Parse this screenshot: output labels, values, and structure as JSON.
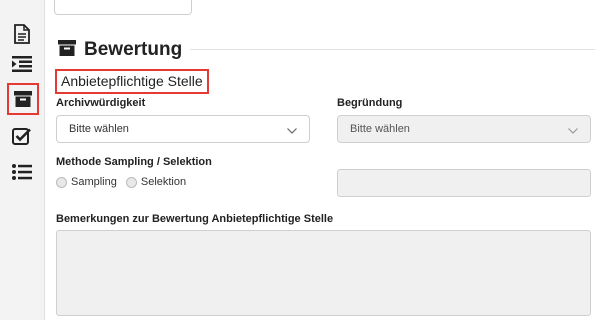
{
  "sidebar": {
    "items": [
      {
        "icon": "document-icon",
        "active": false
      },
      {
        "icon": "indent-list-icon",
        "active": false
      },
      {
        "icon": "archive-box-icon",
        "active": true
      },
      {
        "icon": "checkbox-icon",
        "active": false
      },
      {
        "icon": "bullet-list-icon",
        "active": false
      }
    ]
  },
  "section": {
    "title": "Bewertung",
    "icon": "archive-box-icon",
    "subheading": "Anbietepflichtige Stelle"
  },
  "form": {
    "archiv_label": "Archivwürdigkeit",
    "archiv_value": "Bitte wählen",
    "begruendung_label": "Begründung",
    "begruendung_value": "Bitte wählen",
    "methode_label": "Methode Sampling / Selektion",
    "option_sampling": "Sampling",
    "option_selektion": "Selektion",
    "method_detail_value": "",
    "bemerkungen_label": "Bemerkungen zur Bewertung Anbietepflichtige Stelle",
    "bemerkungen_value": ""
  },
  "colors": {
    "highlight": "#e53935",
    "sidebar_bg": "#f3f3f3",
    "disabled_bg": "#f0f0f0"
  }
}
